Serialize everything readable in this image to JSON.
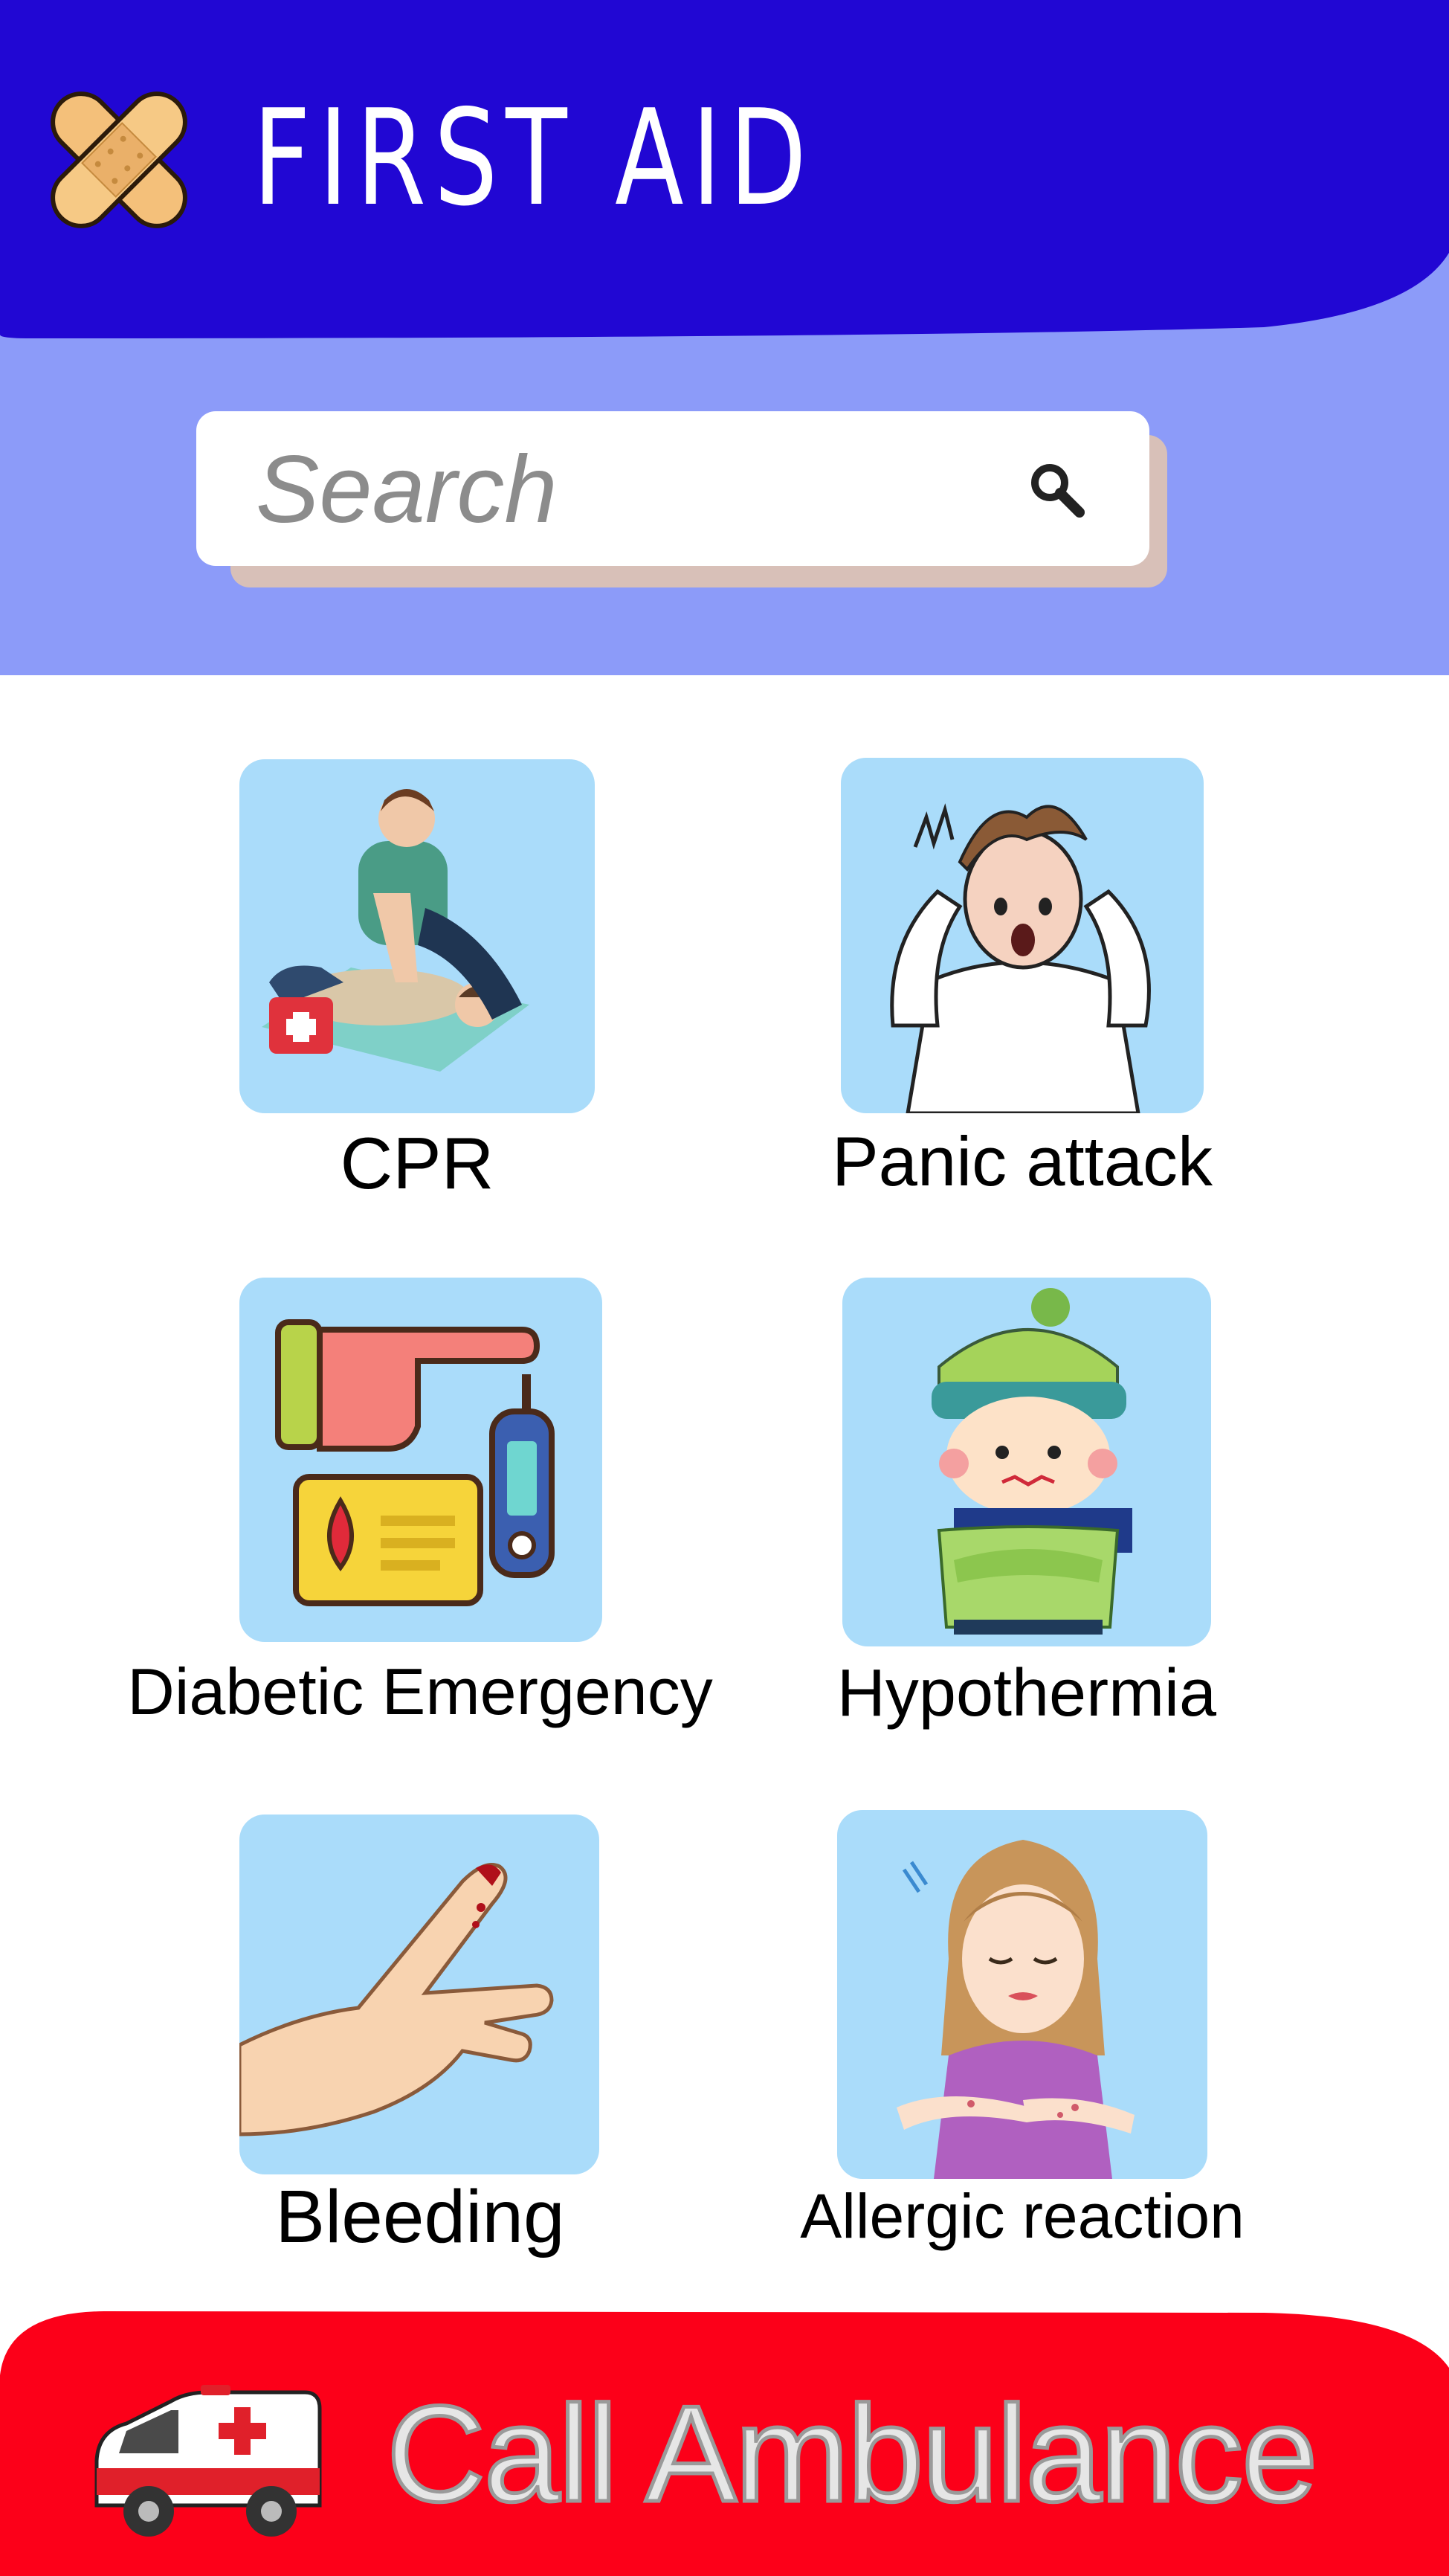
{
  "header": {
    "title": "FIRST AID",
    "logo_icon": "bandage-cross-icon",
    "background_color": "#2107d3"
  },
  "search": {
    "placeholder": "Search",
    "icon": "search-icon"
  },
  "topics": [
    {
      "label": "CPR",
      "icon": "cpr-illustration"
    },
    {
      "label": "Panic attack",
      "icon": "panic-attack-illustration"
    },
    {
      "label": "Diabetic Emergency",
      "icon": "glucose-test-illustration"
    },
    {
      "label": "Hypothermia",
      "icon": "cold-child-illustration"
    },
    {
      "label": "Bleeding",
      "icon": "bleeding-finger-illustration"
    },
    {
      "label": "Allergic reaction",
      "icon": "allergic-reaction-illustration"
    }
  ],
  "ambulance_button": {
    "label": "Call Ambulance",
    "icon": "ambulance-icon",
    "background_color": "#fc0019"
  },
  "colors": {
    "header_blue": "#2107d3",
    "band_lavender": "#8c9bf9",
    "card_bg": "#aadcfa",
    "alert_red": "#fc0019"
  }
}
